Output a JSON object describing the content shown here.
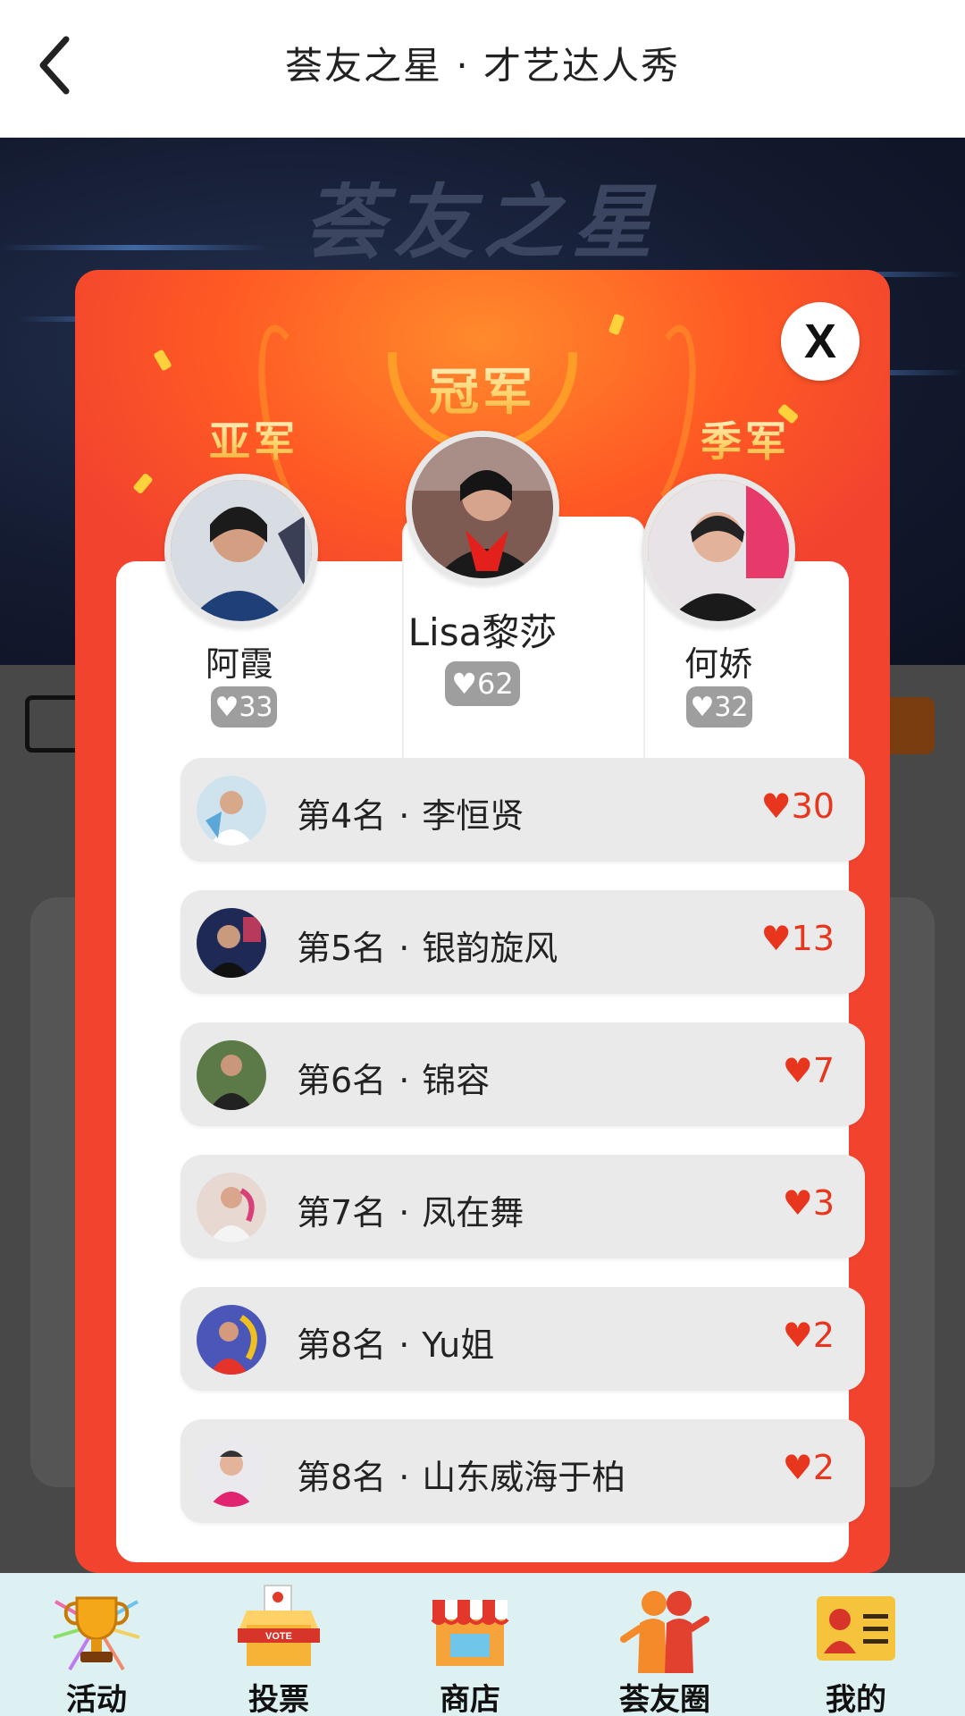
{
  "header": {
    "title": "荟友之星 · 才艺达人秀"
  },
  "background": {
    "banner_title": "荟友之星"
  },
  "modal": {
    "titles": {
      "champion": "冠军",
      "second": "亚军",
      "third": "季军"
    },
    "podium": {
      "champion": {
        "name": "Lisa黎莎",
        "votes": "♥62"
      },
      "second": {
        "name": "阿霞",
        "votes": "♥33"
      },
      "third": {
        "name": "何娇",
        "votes": "♥32"
      }
    },
    "rows": [
      {
        "rank": "第4名",
        "name": "李恒贤",
        "votes": "♥30"
      },
      {
        "rank": "第5名",
        "name": "银韵旋风",
        "votes": "♥13"
      },
      {
        "rank": "第6名",
        "name": "锦容",
        "votes": "♥7"
      },
      {
        "rank": "第7名",
        "name": "凤在舞",
        "votes": "♥3"
      },
      {
        "rank": "第8名",
        "name": "Yu姐",
        "votes": "♥2"
      },
      {
        "rank": "第8名",
        "name": "山东威海于柏",
        "votes": "♥2"
      }
    ],
    "close_label": "X"
  },
  "tabbar": {
    "items": [
      {
        "label": "活动",
        "icon": "trophy-icon"
      },
      {
        "label": "投票",
        "icon": "vote-box-icon"
      },
      {
        "label": "商店",
        "icon": "store-icon"
      },
      {
        "label": "荟友圈",
        "icon": "friends-icon"
      },
      {
        "label": "我的",
        "icon": "profile-card-icon"
      }
    ]
  },
  "colors": {
    "modal_red": "#f2432f",
    "vote_red": "#e8361e",
    "tabbar_bg": "#ddf1f2",
    "gold": "#ffd36a"
  }
}
